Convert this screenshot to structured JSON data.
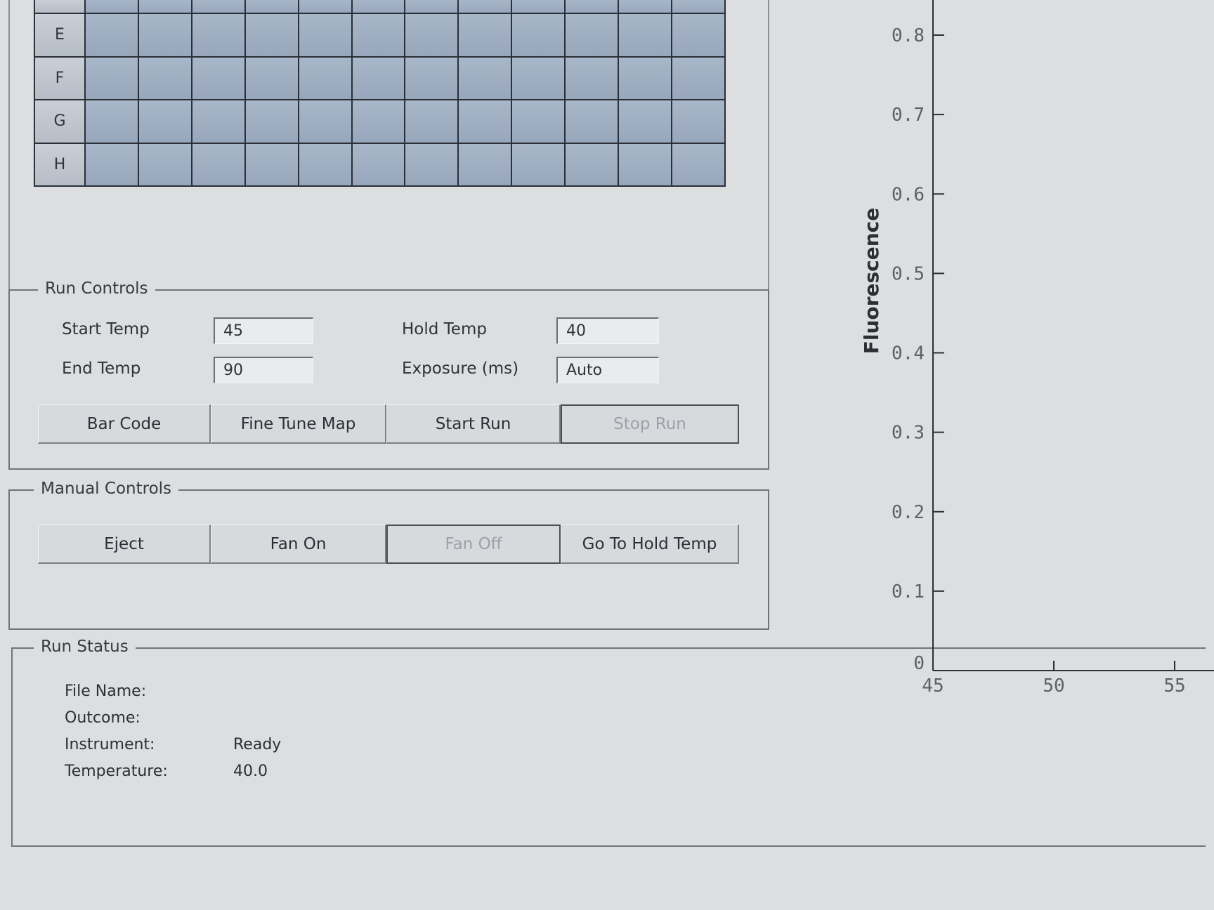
{
  "plate": {
    "row_labels": [
      "E",
      "F",
      "G",
      "H"
    ],
    "columns": 12
  },
  "run_controls": {
    "title": "Run Controls",
    "start_temp_label": "Start Temp",
    "start_temp_value": "45",
    "end_temp_label": "End Temp",
    "end_temp_value": "90",
    "hold_temp_label": "Hold Temp",
    "hold_temp_value": "40",
    "exposure_label": "Exposure (ms)",
    "exposure_value": "Auto",
    "buttons": {
      "bar_code": "Bar Code",
      "fine_tune_map": "Fine Tune Map",
      "start_run": "Start Run",
      "stop_run": "Stop Run"
    }
  },
  "manual_controls": {
    "title": "Manual Controls",
    "buttons": {
      "eject": "Eject",
      "fan_on": "Fan On",
      "fan_off": "Fan Off",
      "go_to_hold_temp": "Go To Hold Temp"
    }
  },
  "run_status": {
    "title": "Run Status",
    "file_name_label": "File Name:",
    "file_name_value": "",
    "outcome_label": "Outcome:",
    "outcome_value": "",
    "instrument_label": "Instrument:",
    "instrument_value": "Ready",
    "temperature_label": "Temperature:",
    "temperature_value": "40.0"
  },
  "chart_data": {
    "type": "line",
    "ylabel": "Fluorescence",
    "xlabel": "",
    "ylim": [
      0,
      0.8
    ],
    "xlim": [
      45,
      55
    ],
    "y_ticks": [
      "0",
      "0.1",
      "0.2",
      "0.3",
      "0.4",
      "0.5",
      "0.6",
      "0.7",
      "0.8"
    ],
    "x_ticks": [
      "45",
      "50",
      "55"
    ],
    "series": []
  }
}
